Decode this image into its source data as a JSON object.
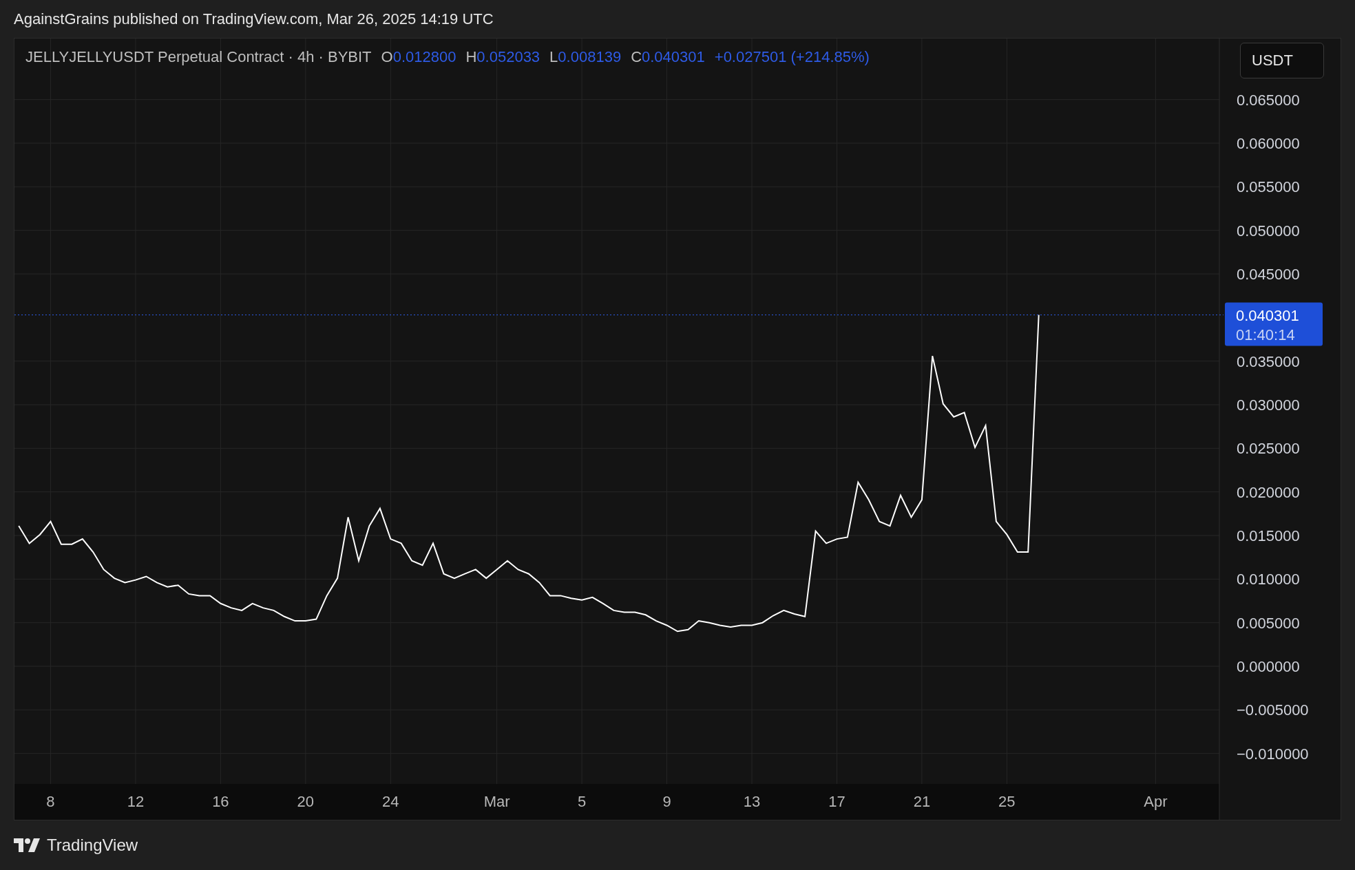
{
  "header": {
    "title": "AgainstGrains published on TradingView.com, Mar 26, 2025 14:19 UTC"
  },
  "legend": {
    "symbol": "JELLYJELLYUSDT Perpetual Contract · 4h · BYBIT",
    "ohlc": [
      {
        "label": "O",
        "value": "0.012800"
      },
      {
        "label": "H",
        "value": "0.052033"
      },
      {
        "label": "L",
        "value": "0.008139"
      },
      {
        "label": "C",
        "value": "0.040301"
      }
    ],
    "change": "+0.027501 (+214.85%)"
  },
  "currency_button": "USDT",
  "price_tag": {
    "price": "0.040301",
    "countdown": "01:40:14"
  },
  "chart_data": {
    "type": "line",
    "ylim": [
      -0.0135,
      0.072
    ],
    "grid": true,
    "ref_lines": [
      {
        "axis": "y",
        "value": 0.040301,
        "color": "#2e5be6"
      }
    ],
    "categories": [
      null,
      null,
      null,
      "8",
      null,
      null,
      null,
      null,
      null,
      null,
      null,
      "12",
      null,
      null,
      null,
      null,
      null,
      null,
      null,
      "16",
      null,
      null,
      null,
      null,
      null,
      null,
      null,
      "20",
      null,
      null,
      null,
      null,
      null,
      null,
      null,
      "24",
      null,
      null,
      null,
      null,
      null,
      null,
      null,
      null,
      null,
      "Mar",
      null,
      null,
      null,
      null,
      null,
      null,
      null,
      "5",
      null,
      null,
      null,
      null,
      null,
      null,
      null,
      "9",
      null,
      null,
      null,
      null,
      null,
      null,
      null,
      "13",
      null,
      null,
      null,
      null,
      null,
      null,
      null,
      "17",
      null,
      null,
      null,
      null,
      null,
      null,
      null,
      "21",
      null,
      null,
      null,
      null,
      null,
      null,
      null,
      "25",
      null,
      null,
      null,
      null,
      null,
      null,
      null,
      null,
      null,
      null,
      null,
      null,
      null,
      "Apr"
    ],
    "series": [
      {
        "color": "#ffffff",
        "values": [
          0.0161,
          0.0141,
          0.0151,
          0.0166,
          0.014,
          0.014,
          0.0146,
          0.0131,
          0.0111,
          0.0101,
          0.0096,
          0.0099,
          0.0103,
          0.0096,
          0.0091,
          0.0093,
          0.0083,
          0.0081,
          0.0081,
          0.0072,
          0.0067,
          0.0064,
          0.0072,
          0.0067,
          0.0064,
          0.0057,
          0.0052,
          0.0052,
          0.0054,
          0.0081,
          0.0101,
          0.0171,
          0.0121,
          0.0161,
          0.0181,
          0.0146,
          0.0141,
          0.0121,
          0.0116,
          0.0141,
          0.0106,
          0.0101,
          0.0106,
          0.0111,
          0.0101,
          0.0111,
          0.0121,
          0.0111,
          0.0106,
          0.0096,
          0.0081,
          0.0081,
          0.0078,
          0.0076,
          0.0079,
          0.0072,
          0.0064,
          0.0062,
          0.0062,
          0.0059,
          0.0052,
          0.0047,
          0.004,
          0.0042,
          0.0052,
          0.005,
          0.0047,
          0.0045,
          0.0047,
          0.0047,
          0.005,
          0.0058,
          0.0064,
          0.006,
          0.0057,
          0.0155,
          0.0141,
          0.0146,
          0.0148,
          0.0211,
          0.0191,
          0.0166,
          0.0161,
          0.0196,
          0.0171,
          0.0191,
          0.0356,
          0.0301,
          0.0286,
          0.0291,
          0.0251,
          0.0276,
          0.0166,
          0.0151,
          0.0131,
          0.0131,
          0.0403,
          null,
          null,
          null,
          null,
          null,
          null,
          null,
          null,
          null,
          null,
          null
        ]
      }
    ],
    "yticks": [
      {
        "value": 0.065,
        "label": "0.065000"
      },
      {
        "value": 0.06,
        "label": "0.060000"
      },
      {
        "value": 0.055,
        "label": "0.055000"
      },
      {
        "value": 0.05,
        "label": "0.050000"
      },
      {
        "value": 0.045,
        "label": "0.045000"
      },
      {
        "value": 0.035,
        "label": "0.035000"
      },
      {
        "value": 0.03,
        "label": "0.030000"
      },
      {
        "value": 0.025,
        "label": "0.025000"
      },
      {
        "value": 0.02,
        "label": "0.020000"
      },
      {
        "value": 0.015,
        "label": "0.015000"
      },
      {
        "value": 0.01,
        "label": "0.010000"
      },
      {
        "value": 0.005,
        "label": "0.005000"
      },
      {
        "value": 0,
        "label": "0.000000"
      },
      {
        "value": -0.005,
        "label": "−0.005000"
      },
      {
        "value": -0.01,
        "label": "−0.010000"
      }
    ]
  },
  "footer": {
    "brand": "TradingView"
  }
}
